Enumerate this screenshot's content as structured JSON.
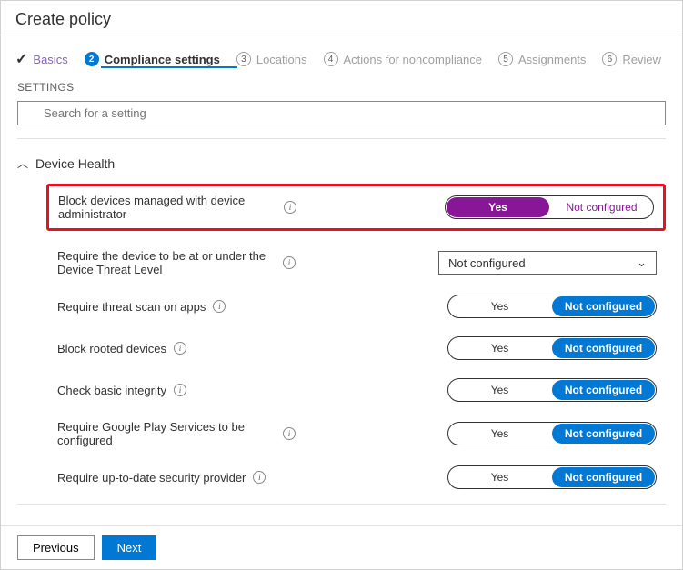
{
  "header": {
    "title": "Create policy"
  },
  "steps": [
    {
      "label": "Basics"
    },
    {
      "num": "2",
      "label": "Compliance settings"
    },
    {
      "num": "3",
      "label": "Locations"
    },
    {
      "num": "4",
      "label": "Actions for noncompliance"
    },
    {
      "num": "5",
      "label": "Assignments"
    },
    {
      "num": "6",
      "label": "Review"
    }
  ],
  "settingsLabel": "SETTINGS",
  "search": {
    "placeholder": "Search for a setting"
  },
  "section": {
    "title": "Device Health"
  },
  "pillOptions": {
    "yes": "Yes",
    "nc": "Not configured"
  },
  "dropdown": {
    "value": "Not configured"
  },
  "rows": {
    "blockAdmin": {
      "label": "Block devices managed with device administrator"
    },
    "threatLevel": {
      "label": "Require the device to be at or under the Device Threat Level"
    },
    "threatScan": {
      "label": "Require threat scan on apps"
    },
    "rooted": {
      "label": "Block rooted devices"
    },
    "integrity": {
      "label": "Check basic integrity"
    },
    "playServices": {
      "label": "Require Google Play Services to be configured"
    },
    "securityProvider": {
      "label": "Require up-to-date security provider"
    }
  },
  "footer": {
    "previous": "Previous",
    "next": "Next"
  }
}
